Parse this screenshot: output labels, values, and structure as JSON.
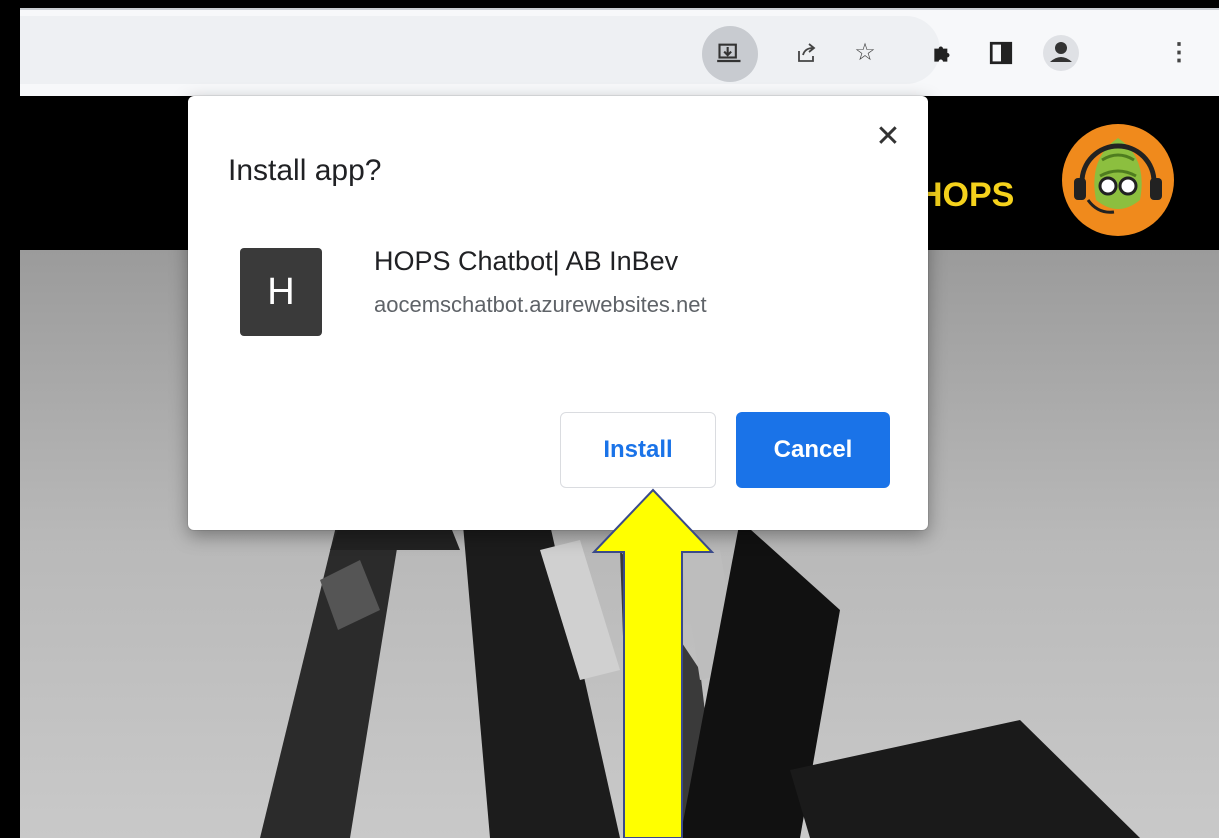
{
  "browser": {
    "toolbar_icons": [
      "install-app-icon",
      "share-icon",
      "bookmark-star-icon",
      "extensions-icon",
      "side-panel-icon",
      "profile-icon",
      "more-menu-icon"
    ]
  },
  "site": {
    "brand": "HOPS",
    "header_color": "#000000",
    "brand_color": "#f5d21c"
  },
  "dialog": {
    "title": "Install app?",
    "close_glyph": "✕",
    "app_initial": "H",
    "app_name": "HOPS Chatbot| AB InBev",
    "app_url": "aocemschatbot.azurewebsites.net",
    "install_label": "Install",
    "cancel_label": "Cancel",
    "accent_color": "#1a73e8"
  },
  "annotation": {
    "arrow_color": "#ffff00",
    "points_to": "Install"
  }
}
